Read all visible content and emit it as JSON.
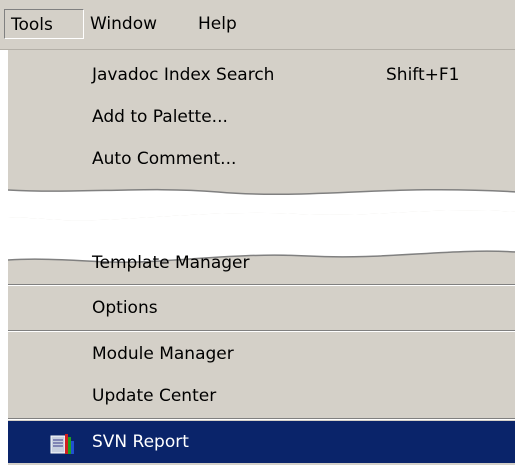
{
  "menubar": {
    "items": [
      {
        "label": "Tools"
      },
      {
        "label": "Window"
      },
      {
        "label": "Help"
      }
    ]
  },
  "dropdown": {
    "items": [
      {
        "label": "Javadoc Index Search",
        "shortcut": "Shift+F1"
      },
      {
        "label": "Add to Palette..."
      },
      {
        "label": "Auto Comment..."
      },
      {
        "label": "Template Manager"
      },
      {
        "label": "Options"
      },
      {
        "label": "Module Manager"
      },
      {
        "label": "Update Center"
      },
      {
        "label": "SVN Report",
        "icon": "svn-report-icon",
        "highlighted": true
      }
    ]
  },
  "colors": {
    "menu_background": "#d4d0c8",
    "highlight": "#0a246a",
    "highlight_text": "#ffffff"
  }
}
